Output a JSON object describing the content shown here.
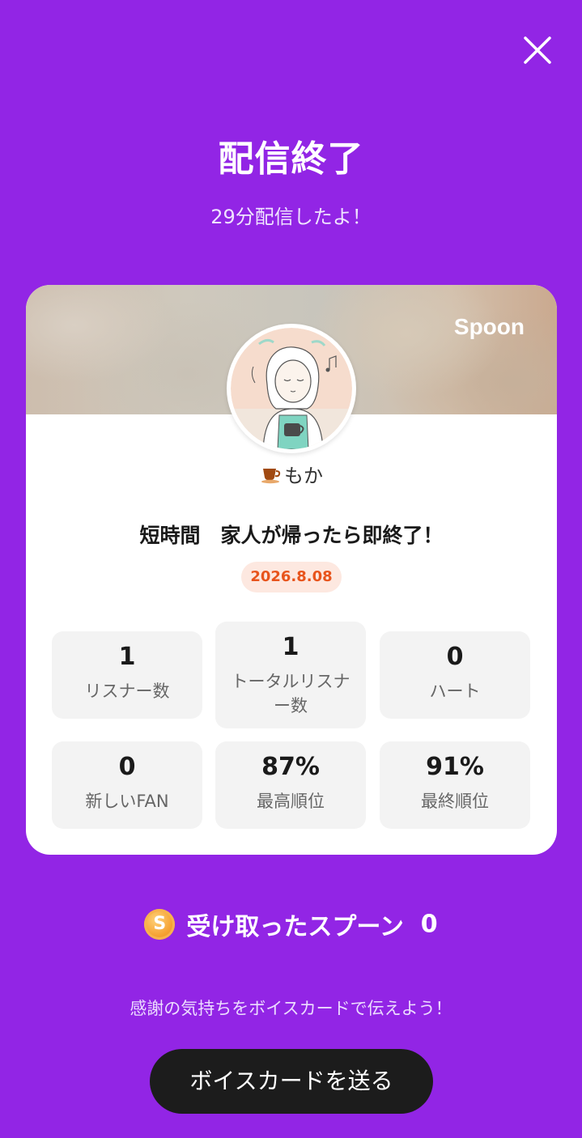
{
  "header": {
    "close_icon": "close-icon",
    "title": "配信終了",
    "subtitle": "29分配信したよ！"
  },
  "card": {
    "brand": "Spoon",
    "username": "もか",
    "username_icon": "coffee-cup-icon",
    "cast_title": "短時間　家人が帰ったら即終了！",
    "date": "2026.8.08",
    "stats": [
      {
        "value": "1",
        "label": "リスナー数"
      },
      {
        "value": "1",
        "label": "トータルリスナー数"
      },
      {
        "value": "0",
        "label": "ハート"
      },
      {
        "value": "0",
        "label": "新しいFAN"
      },
      {
        "value": "87%",
        "label": "最高順位"
      },
      {
        "value": "91%",
        "label": "最終順位"
      }
    ]
  },
  "spoons": {
    "icon": "spoon-coin-icon",
    "coin_letter": "S",
    "label": "受け取ったスプーン",
    "count": "0"
  },
  "footer": {
    "thanks_text": "感謝の気持ちをボイスカードで伝えよう！",
    "send_button": "ボイスカードを送る"
  },
  "colors": {
    "background": "#9225e5",
    "card": "#ffffff",
    "date_badge_bg": "#fde8e0",
    "date_badge_text": "#e8541c",
    "button": "#1c1c1c",
    "coin": "#f5a031"
  }
}
